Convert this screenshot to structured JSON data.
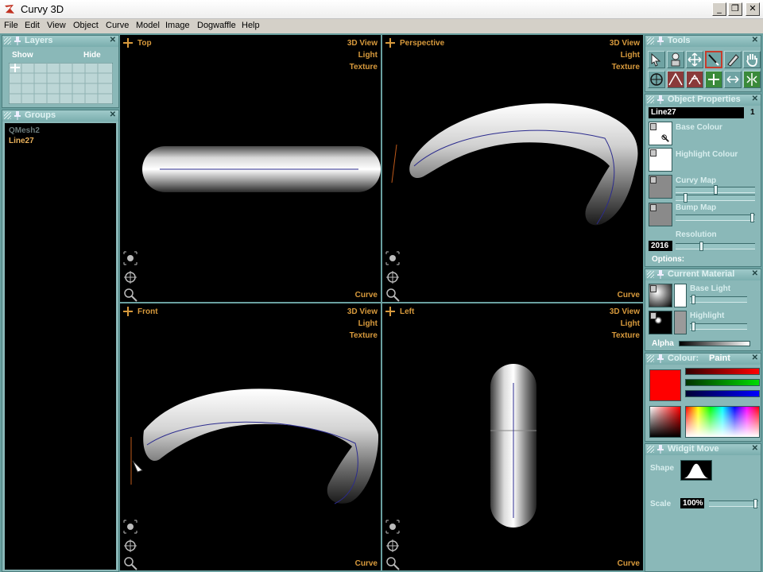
{
  "window": {
    "title": "Curvy 3D",
    "minimize": "_",
    "restore": "❐",
    "close": "✕"
  },
  "menu": [
    "File",
    "Edit",
    "View",
    "Object",
    "Curve",
    "Model",
    "Image",
    "Dogwaffle",
    "Help"
  ],
  "layers": {
    "title": "Layers",
    "show": "Show",
    "hide": "Hide"
  },
  "groups": {
    "title": "Groups",
    "items": [
      {
        "label": "QMesh2",
        "selected": false
      },
      {
        "label": "Line27",
        "selected": true
      }
    ]
  },
  "viewports": {
    "top": {
      "title": "Top",
      "view": "3D View",
      "light": "Light",
      "texture": "Texture",
      "mode": "Curve"
    },
    "perspective": {
      "title": "Perspective",
      "view": "3D View",
      "light": "Light",
      "texture": "Texture",
      "mode": "Curve"
    },
    "front": {
      "title": "Front",
      "view": "3D View",
      "light": "Light",
      "texture": "Texture",
      "mode": "Curve"
    },
    "left": {
      "title": "Left",
      "view": "3D View",
      "light": "Light",
      "texture": "Texture",
      "mode": "Curve"
    }
  },
  "tools": {
    "title": "Tools"
  },
  "object_properties": {
    "title": "Object Properties",
    "name": "Line27",
    "count": "1",
    "base_colour": "Base Colour",
    "highlight_colour": "Highlight Colour",
    "curvy_map": "Curvy Map",
    "bump_map": "Bump Map",
    "resolution_label": "Resolution",
    "resolution_value": "2016",
    "options": "Options:"
  },
  "current_material": {
    "title": "Current Material",
    "base_light": "Base Light",
    "highlight": "Highlight",
    "alpha": "Alpha"
  },
  "colour": {
    "title": "Colour:",
    "mode": "Paint",
    "r": 1.0,
    "g": 1.0,
    "b": 1.0,
    "current": "#ff0000"
  },
  "widgit_move": {
    "title": "Widgit Move",
    "shape": "Shape",
    "scale": "Scale",
    "scale_value": "100%"
  },
  "colors": {
    "panel": "#8ab8b8",
    "app_bg": "#6aa0a0",
    "accent_text": "#d89a3c",
    "selected_group": "#e8b05a"
  }
}
